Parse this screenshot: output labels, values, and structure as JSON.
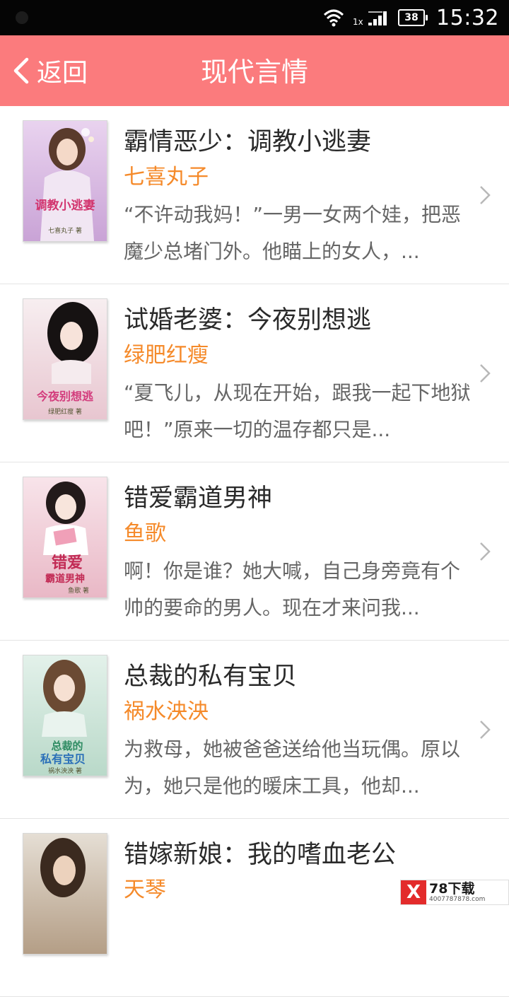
{
  "status_bar": {
    "signal_text": "1x",
    "battery": "38",
    "time": "15:32"
  },
  "header": {
    "back_label": "返回",
    "title": "现代言情"
  },
  "books": [
    {
      "title": "霸情恶少：调教小逃妻",
      "author": "七喜丸子",
      "desc": "“不许动我妈！”一男一女两个娃，把恶魔少总堵门外。他瞄上的女人，...",
      "cover_colors": [
        "#e9d3ef",
        "#c9a3d6"
      ],
      "cover_text": "调教小逃妻",
      "cover_author": "七喜丸子 著"
    },
    {
      "title": "试婚老婆：今夜别想逃",
      "author": "绿肥红瘦",
      "desc": "“夏飞儿，从现在开始，跟我一起下地狱吧！”原来一切的温存都只是...",
      "cover_colors": [
        "#f7eef0",
        "#e8c6d0"
      ],
      "cover_text": "今夜别想逃",
      "cover_author": "绿肥红瘦 著"
    },
    {
      "title": "错爱霸道男神",
      "author": "鱼歌",
      "desc": "啊！你是谁？她大喊，自己身旁竟有个帅的要命的男人。现在才来问我...",
      "cover_colors": [
        "#f8e4ea",
        "#e9b8c6"
      ],
      "cover_text": "霸道男神",
      "cover_author": "鱼歌 著"
    },
    {
      "title": "总裁的私有宝贝",
      "author": "祸水泱泱",
      "desc": "为救母，她被爸爸送给他当玩偶。原以为，她只是他的暖床工具，他却...",
      "cover_colors": [
        "#e3f1ea",
        "#b9d9c9"
      ],
      "cover_text": "私有宝贝",
      "cover_author": "祸水泱泱 著"
    },
    {
      "title": "错嫁新娘：我的嗜血老公",
      "author": "天琴",
      "desc": "",
      "cover_colors": [
        "#e5ded4",
        "#b49e86"
      ],
      "cover_text": "",
      "cover_author": ""
    }
  ],
  "watermark": {
    "logo": "X",
    "brand": "78下载",
    "phone": "4007787878.com"
  },
  "colors": {
    "header_bg": "#fb7b7d",
    "author": "#f58a2a",
    "title": "#2a2a2a",
    "desc": "#666666"
  }
}
